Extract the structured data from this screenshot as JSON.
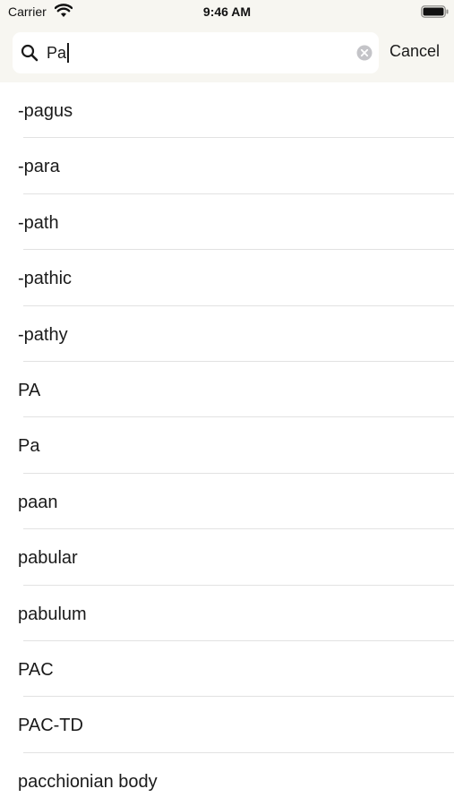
{
  "status_bar": {
    "carrier": "Carrier",
    "time": "9:46 AM"
  },
  "search": {
    "value": "Pa",
    "cancel_label": "Cancel",
    "icons": [
      "search-icon",
      "clear-icon"
    ]
  },
  "results": [
    {
      "label": "-pagus"
    },
    {
      "label": "-para"
    },
    {
      "label": "-path"
    },
    {
      "label": "-pathic"
    },
    {
      "label": "-pathy"
    },
    {
      "label": "PA"
    },
    {
      "label": "Pa"
    },
    {
      "label": "paan"
    },
    {
      "label": "pabular"
    },
    {
      "label": "pabulum"
    },
    {
      "label": "PAC"
    },
    {
      "label": "PAC-TD"
    },
    {
      "label": "pacchionian body"
    }
  ],
  "colors": {
    "header_bg": "#f7f6f1",
    "search_field_bg": "#ffffff",
    "separator": "#e2e2e2",
    "text": "#1a1a1a"
  }
}
